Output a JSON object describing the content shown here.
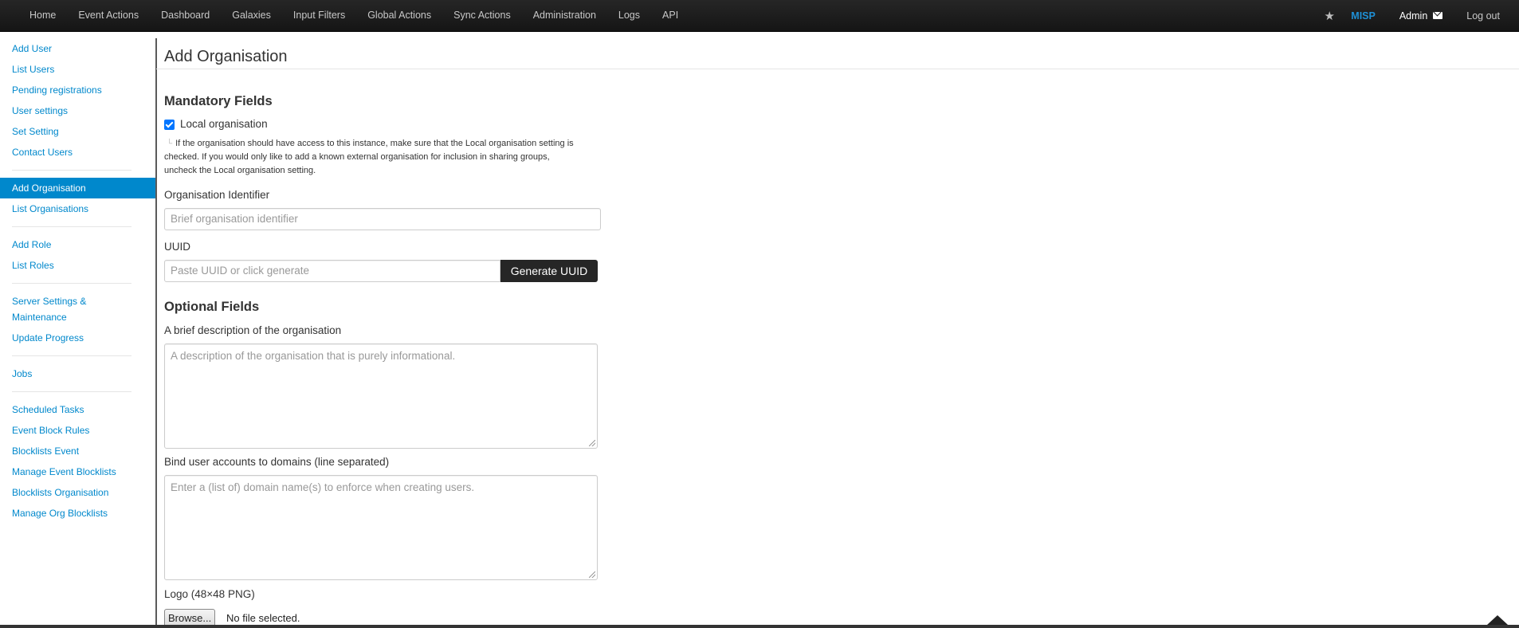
{
  "navbar": {
    "items": [
      "Home",
      "Event Actions",
      "Dashboard",
      "Galaxies",
      "Input Filters",
      "Global Actions",
      "Sync Actions",
      "Administration",
      "Logs",
      "API"
    ],
    "brand": "MISP",
    "user": "Admin",
    "logout": "Log out",
    "icons": {
      "star": "star-icon",
      "mail": "envelope-icon"
    }
  },
  "sidebar": {
    "group1": [
      "Add User",
      "List Users",
      "Pending registrations",
      "User settings",
      "Set Setting",
      "Contact Users"
    ],
    "group2": [
      "Add Organisation",
      "List Organisations"
    ],
    "group3": [
      "Add Role",
      "List Roles"
    ],
    "group4": [
      "Server Settings & Maintenance",
      "Update Progress"
    ],
    "group5": [
      "Jobs"
    ],
    "group6": [
      "Scheduled Tasks",
      "Event Block Rules",
      "Blocklists Event",
      "Manage Event Blocklists",
      "Blocklists Organisation",
      "Manage Org Blocklists"
    ],
    "active": "Add Organisation"
  },
  "form": {
    "title": "Add Organisation",
    "mandatory_heading": "Mandatory Fields",
    "local_org_label": "Local organisation",
    "local_org_checked": true,
    "local_org_help": "If the organisation should have access to this instance, make sure that the Local organisation setting is checked. If you would only like to add a known external organisation for inclusion in sharing groups, uncheck the Local organisation setting.",
    "org_identifier_label": "Organisation Identifier",
    "org_identifier_placeholder": "Brief organisation identifier",
    "uuid_label": "UUID",
    "uuid_placeholder": "Paste UUID or click generate",
    "generate_uuid": "Generate UUID",
    "optional_heading": "Optional Fields",
    "description_label": "A brief description of the organisation",
    "description_placeholder": "A description of the organisation that is purely informational.",
    "domains_label": "Bind user accounts to domains (line separated)",
    "domains_placeholder": "Enter a (list of) domain name(s) to enforce when creating users.",
    "logo_label": "Logo (48×48 PNG)",
    "browse": "Browse...",
    "no_file": "No file selected."
  },
  "colors": {
    "link": "#0088cc",
    "brand": "#1e90d6",
    "navbar": "#1c1c1c",
    "checkbox": "#0075ff"
  }
}
